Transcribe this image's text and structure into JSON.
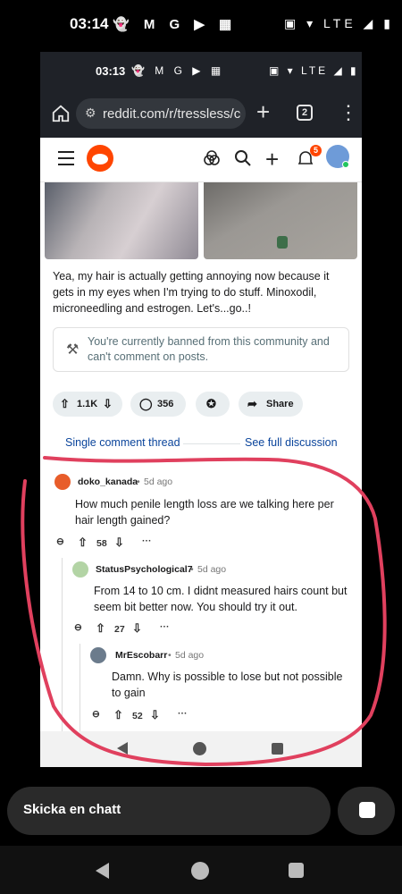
{
  "outer_status": {
    "time": "03:14",
    "left_icons": "👻 M G ▶ ▦",
    "right_icons": "▣ ▾ LTE ◢ ▮"
  },
  "inner_status": {
    "time": "03:13",
    "left_icons": "👻 M G ▶ ▦",
    "right_icons": "▣ ▾ LTE ◢ ▮"
  },
  "browser": {
    "url": "reddit.com/r/tressless/cc",
    "tab_count": "2"
  },
  "header": {
    "notification_count": "5"
  },
  "post": {
    "body": "Yea, my hair is actually getting annoying now because it gets in my eyes when I'm trying to do stuff. Minoxodil, microneedling and estrogen. Let's...go..!",
    "ban_notice": "You're currently banned from this community and can't comment on posts.",
    "votes": "1.1K",
    "comments": "356",
    "share_label": "Share"
  },
  "thread_links": {
    "single": "Single comment thread",
    "full": "See full discussion"
  },
  "comments": [
    {
      "user": "doko_kanada",
      "age": "5d ago",
      "body": "How much penile length loss are we talking here per hair length gained?",
      "score": "58"
    },
    {
      "user": "StatusPsychological7",
      "age": "5d ago",
      "body": "From 14 to 10 cm. I didnt measured hairs count but seem bit better now. You should try it out.",
      "score": "27"
    },
    {
      "user": "MrEscobarr",
      "age": "5d ago",
      "body": "Damn. Why is possible to lose but not possible to gain",
      "score": "52"
    }
  ],
  "chat": {
    "placeholder": "Skicka en chatt"
  },
  "colors": {
    "reddit_orange": "#ff4500",
    "link_blue": "#0a449b",
    "annotation_red": "#e0405e"
  }
}
